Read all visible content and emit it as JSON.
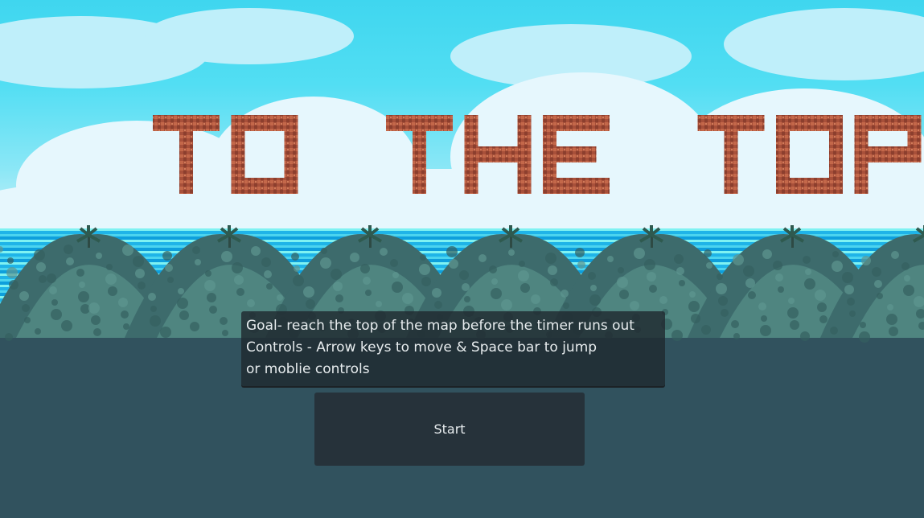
{
  "game": {
    "title": "TO THE TOP",
    "goal_text": "Goal- reach the top of the map before the timer runs out",
    "controls_text": "Controls - Arrow keys to move & Space bar to jump",
    "alt_controls_text": "or moblie controls",
    "start_label": "Start"
  },
  "colors": {
    "sky": "#3fd6ef",
    "cloud": "#e6f7fd",
    "sea": "#1fb4e8",
    "hills": "#31525e",
    "title_blocks": "#a8503a",
    "panel": "#202a30",
    "button": "#26323a",
    "text": "#e7ecee"
  }
}
